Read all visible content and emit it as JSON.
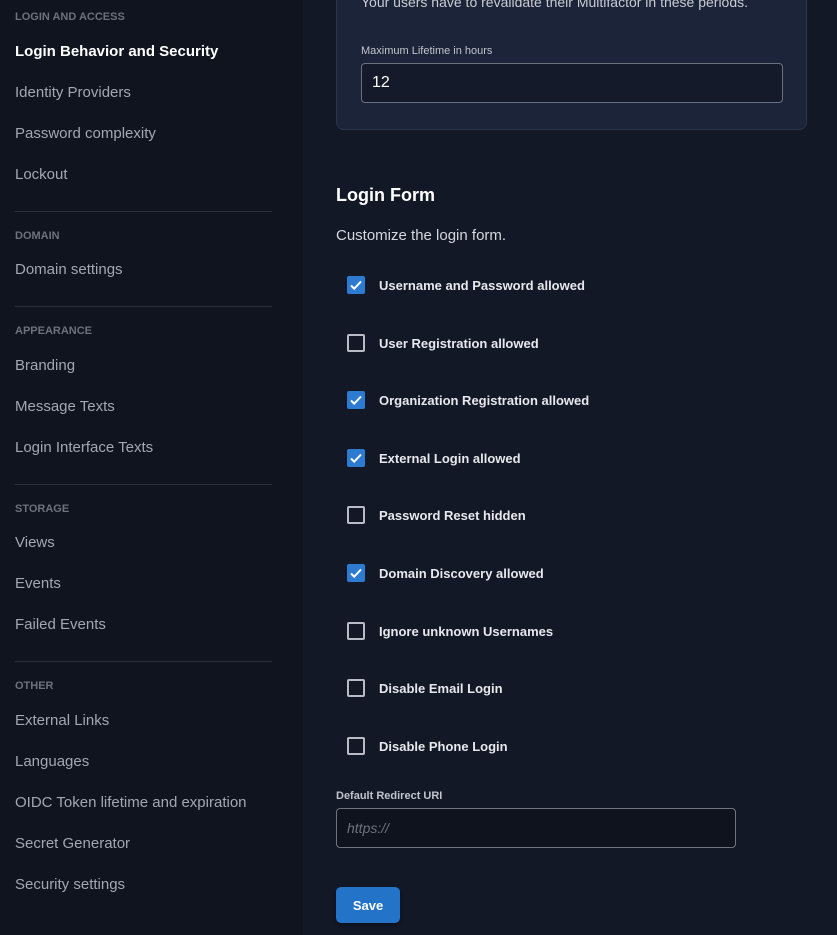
{
  "sidebar": {
    "sections": [
      {
        "header": "Login and Access",
        "items": [
          "Login Behavior and Security",
          "Identity Providers",
          "Password complexity",
          "Lockout"
        ]
      },
      {
        "header": "Domain",
        "items": [
          "Domain settings"
        ]
      },
      {
        "header": "Appearance",
        "items": [
          "Branding",
          "Message Texts",
          "Login Interface Texts"
        ]
      },
      {
        "header": "Storage",
        "items": [
          "Views",
          "Events",
          "Failed Events"
        ]
      },
      {
        "header": "Other",
        "items": [
          "External Links",
          "Languages",
          "OIDC Token lifetime and expiration",
          "Secret Generator",
          "Security settings"
        ]
      }
    ],
    "active": "Login Behavior and Security"
  },
  "lifetime": {
    "description": "Your users have to revalidate their Multifactor in these periods.",
    "label": "Maximum Lifetime in hours",
    "value": "12"
  },
  "login_form": {
    "title": "Login Form",
    "subtitle": "Customize the login form.",
    "options": [
      {
        "label": "Username and Password allowed",
        "checked": true
      },
      {
        "label": "User Registration allowed",
        "checked": false
      },
      {
        "label": "Organization Registration allowed",
        "checked": true
      },
      {
        "label": "External Login allowed",
        "checked": true
      },
      {
        "label": "Password Reset hidden",
        "checked": false
      },
      {
        "label": "Domain Discovery allowed",
        "checked": true
      },
      {
        "label": "Ignore unknown Usernames",
        "checked": false
      },
      {
        "label": "Disable Email Login",
        "checked": false
      },
      {
        "label": "Disable Phone Login",
        "checked": false
      }
    ],
    "redirect_label": "Default Redirect URI",
    "redirect_placeholder": "https://",
    "redirect_value": "",
    "save_label": "Save"
  },
  "colors": {
    "accent": "#2d7bd1",
    "card": "#1b2439",
    "background": "#131827"
  }
}
